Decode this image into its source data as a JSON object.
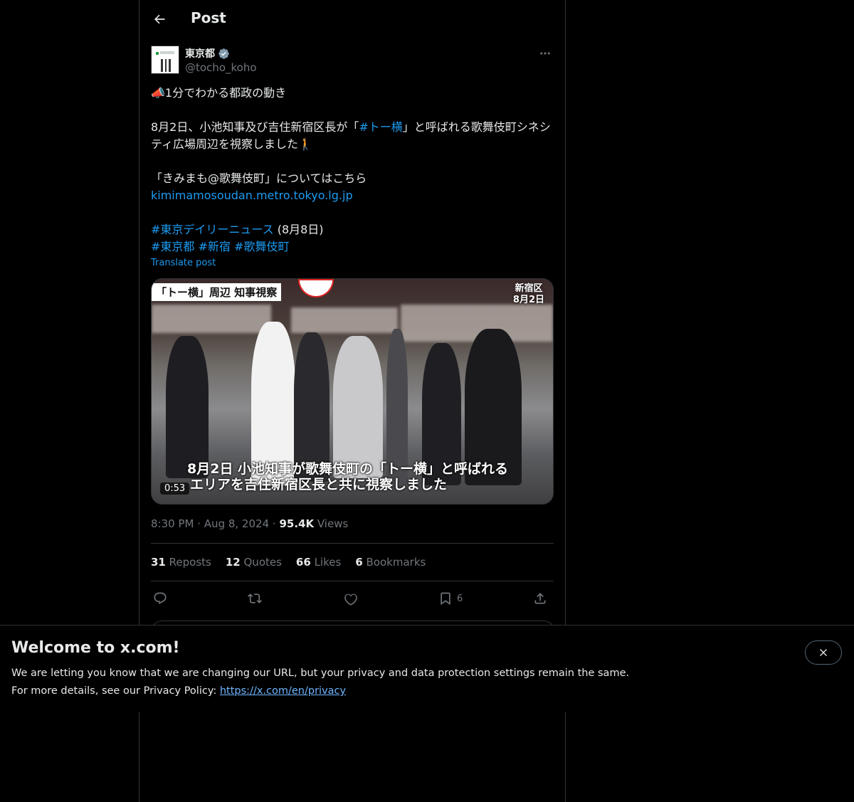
{
  "header": {
    "title": "Post"
  },
  "author": {
    "name": "東京都",
    "handle": "@tocho_koho"
  },
  "post": {
    "line1": "📣1分でわかる都政の動き",
    "line2a": "8月2日、小池知事及び吉住新宿区長が「",
    "line2_hashtag": "#トー横",
    "line2b": "」と呼ばれる歌舞伎町シネシティ広場周辺を視察しました🚶",
    "line3": "「きみまも@歌舞伎町」についてはこちら",
    "link": "kimimamosoudan.metro.tokyo.lg.jp",
    "hashtag_news": "#東京デイリーニュース",
    "news_date": " (8月8日)",
    "hashtags": [
      "#東京都",
      "#新宿",
      "#歌舞伎町"
    ],
    "translate": "Translate post"
  },
  "media": {
    "tag_left": "「トー横」周辺 知事視察",
    "tag_right_line1": "新宿区",
    "tag_right_line2": "8月2日",
    "caption_line1": "8月2日 小池知事が歌舞伎町の「トー横」と呼ばれる",
    "caption_line2": "エリアを吉住新宿区長と共に視察しました",
    "duration": "0:53"
  },
  "meta": {
    "time": "8:30 PM",
    "date": "Aug 8, 2024",
    "views_count": "95.4K",
    "views_label": "Views",
    "sep": "·"
  },
  "stats": {
    "reposts_count": "31",
    "reposts_label": "Reposts",
    "quotes_count": "12",
    "quotes_label": "Quotes",
    "likes_count": "66",
    "likes_label": "Likes",
    "bookmarks_count": "6",
    "bookmarks_label": "Bookmarks"
  },
  "actions": {
    "bookmark_count": "6"
  },
  "banner": {
    "title": "Welcome to x.com!",
    "line1": "We are letting you know that we are changing our URL, but your privacy and data protection settings remain the same.",
    "line2": "For more details, see our Privacy Policy: ",
    "link": "https://x.com/en/privacy"
  },
  "colors": {
    "accent": "#1d9bf0",
    "background": "#000000",
    "muted": "#71767b",
    "border": "#2f3336"
  },
  "icons": [
    "back-arrow-icon",
    "verified-badge-icon",
    "more-icon",
    "reply-icon",
    "repost-icon",
    "like-icon",
    "bookmark-icon",
    "share-icon",
    "close-icon"
  ]
}
